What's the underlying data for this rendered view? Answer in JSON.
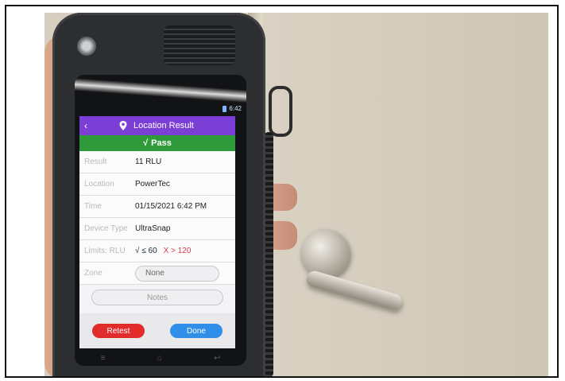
{
  "status_bar": {
    "time": "6:42"
  },
  "app": {
    "title": "Location Result",
    "back_icon": "chevron-left-icon",
    "location_icon": "map-pin-icon"
  },
  "result_banner": {
    "check": "√",
    "text": "Pass",
    "color": "#2f9a3a"
  },
  "details": {
    "result": {
      "label": "Result",
      "value": "11 RLU"
    },
    "location": {
      "label": "Location",
      "value": "PowerTec"
    },
    "time": {
      "label": "Time",
      "value": "01/15/2021 6:42 PM"
    },
    "device_type": {
      "label": "Device Type",
      "value": "UltraSnap"
    },
    "limits": {
      "label": "Limits: RLU",
      "pass_text": "√ ≤ 60",
      "fail_text": "X > 120"
    },
    "zone": {
      "label": "Zone",
      "value": "None"
    },
    "notes": {
      "placeholder": "Notes"
    }
  },
  "actions": {
    "retest_label": "Retest",
    "done_label": "Done"
  },
  "android_nav": {
    "menu": "≡",
    "home": "⌂",
    "back": "↩"
  },
  "colors": {
    "titlebar": "#7b3fd6",
    "retest": "#e22b2b",
    "done": "#2f8ee8",
    "fail_limit": "#d33c4b"
  }
}
